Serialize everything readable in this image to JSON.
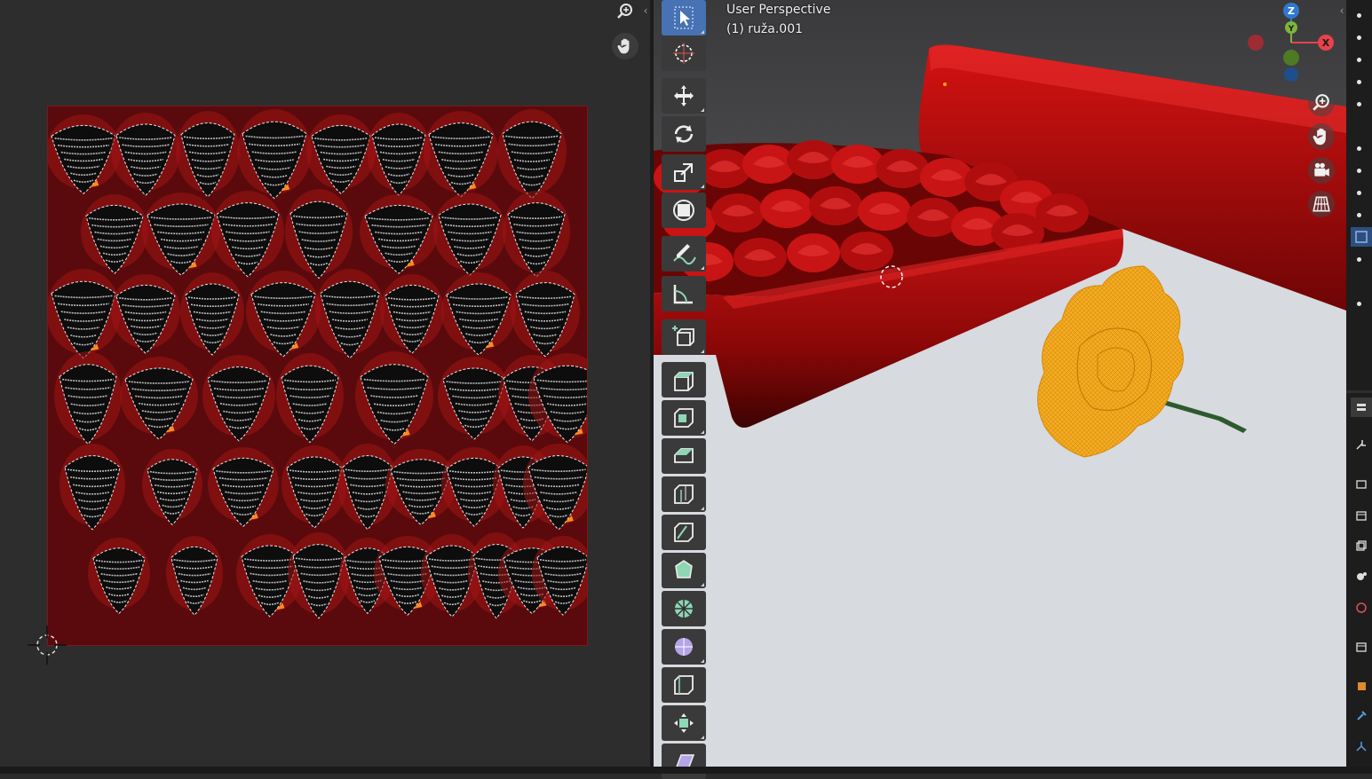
{
  "uv_editor": {
    "nav_icons": [
      "zoom-icon",
      "hand-pan-icon"
    ],
    "background_color": "#2d2d2d",
    "texture_color": "#5a0a0c"
  },
  "viewport": {
    "view_name": "User Perspective",
    "object_name": "(1) ruža.001",
    "gizmo": {
      "x_label": "X",
      "y_label": "Y",
      "z_label": "Z"
    },
    "nav_icons": [
      "zoom-icon",
      "hand-pan-icon",
      "camera-icon",
      "grid-icon"
    ]
  },
  "toolbar": {
    "tools": [
      "select-box-icon",
      "cursor-icon",
      "move-icon",
      "rotate-icon",
      "scale-icon",
      "transform-icon",
      "annotate-icon",
      "measure-icon",
      "add-cube-icon",
      "extrude-region-icon",
      "inset-faces-icon",
      "bevel-icon",
      "loop-cut-icon",
      "knife-icon",
      "poly-build-icon",
      "spin-icon",
      "smooth-icon",
      "edge-slide-icon",
      "shrink-fatten-icon",
      "shear-icon"
    ],
    "active_tool": "select-box-icon"
  },
  "colors": {
    "accent": "#4772b3",
    "x_axis": "#e8424b",
    "y_axis": "#7fb53a",
    "z_axis": "#2f78d1",
    "selection": "#f2a818"
  }
}
